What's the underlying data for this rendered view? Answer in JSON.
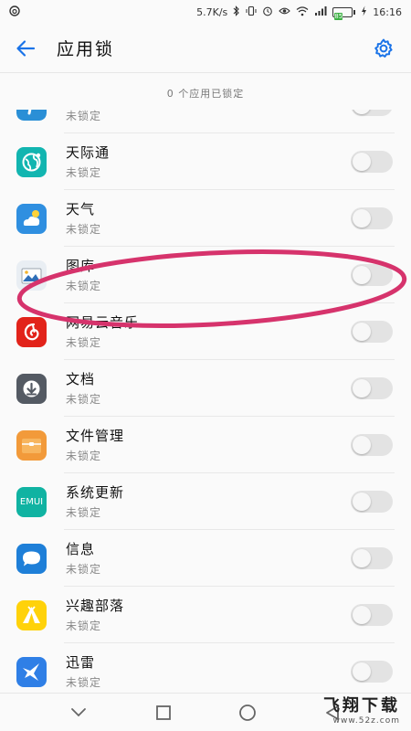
{
  "status_bar": {
    "net_speed": "5.7K/s",
    "battery_level": "85",
    "time": "16:16"
  },
  "header": {
    "title": "应用锁"
  },
  "summary": {
    "text": "0 个应用已锁定"
  },
  "apps": [
    {
      "name": "",
      "status": "未锁定",
      "icon": "partial-app-icon",
      "color": "#2a8fd6",
      "locked": false
    },
    {
      "name": "天际通",
      "status": "未锁定",
      "icon": "globe-icon",
      "color": "#12b5b0",
      "locked": false
    },
    {
      "name": "天气",
      "status": "未锁定",
      "icon": "weather-icon",
      "color": "#2f8fe0",
      "locked": false
    },
    {
      "name": "图库",
      "status": "未锁定",
      "icon": "gallery-icon",
      "color": "#e9eef3",
      "locked": false
    },
    {
      "name": "网易云音乐",
      "status": "未锁定",
      "icon": "netease-music-icon",
      "color": "#e2231a",
      "locked": false
    },
    {
      "name": "文档",
      "status": "未锁定",
      "icon": "download-document-icon",
      "color": "#545a63",
      "locked": false
    },
    {
      "name": "文件管理",
      "status": "未锁定",
      "icon": "folder-icon",
      "color": "#f29a3a",
      "locked": false
    },
    {
      "name": "系统更新",
      "status": "未锁定",
      "icon": "emui-icon",
      "color": "#10b3a2",
      "locked": false
    },
    {
      "name": "信息",
      "status": "未锁定",
      "icon": "message-icon",
      "color": "#1e7fd8",
      "locked": false
    },
    {
      "name": "兴趣部落",
      "status": "未锁定",
      "icon": "tent-icon",
      "color": "#ffd20a",
      "locked": false
    },
    {
      "name": "迅雷",
      "status": "未锁定",
      "icon": "bird-icon",
      "color": "#2f7fe6",
      "locked": false
    }
  ],
  "emui_icon_text": "EMUI",
  "watermark": {
    "main": "飞翔下载",
    "sub": "www.52z.com"
  },
  "colors": {
    "accent": "#1a73e8",
    "annotation": "#d6336c",
    "toggle_off": "#e3e3e3"
  }
}
